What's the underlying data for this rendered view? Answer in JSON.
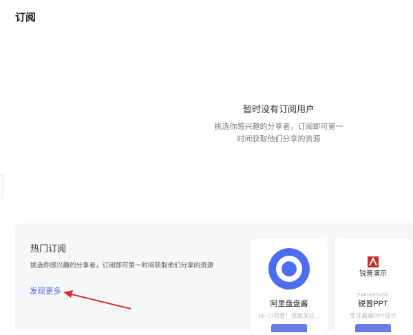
{
  "page": {
    "title": "订阅"
  },
  "empty_state": {
    "title": "暂时没有订阅用户",
    "description_line1": "挑选你感兴趣的分享者，订阅即可第一",
    "description_line2": "时间获取他们分享的资源"
  },
  "hot_subscriptions": {
    "title": "热门订阅",
    "description": "挑选你感兴趣的分享者，订阅即可第一时间获取他们分享的资源",
    "discover_link": "发现更多",
    "cards": [
      {
        "name": "阿里盘盘酱",
        "description": "Hi~小可爱！感恩关注...",
        "logo_icon": "aliyun-drive-logo-icon"
      },
      {
        "name": "锐普PPT",
        "description": "专注高端PPT设计",
        "logo_icon": "ruipu-logo-icon",
        "logo_text": "锐普演示",
        "logo_subtext": "YAPIKESIOP"
      }
    ]
  },
  "colors": {
    "accent": "#5668d8",
    "arrow": "#d32f2f",
    "section_background": "#f6f7f9",
    "button": "#6a7be8"
  }
}
